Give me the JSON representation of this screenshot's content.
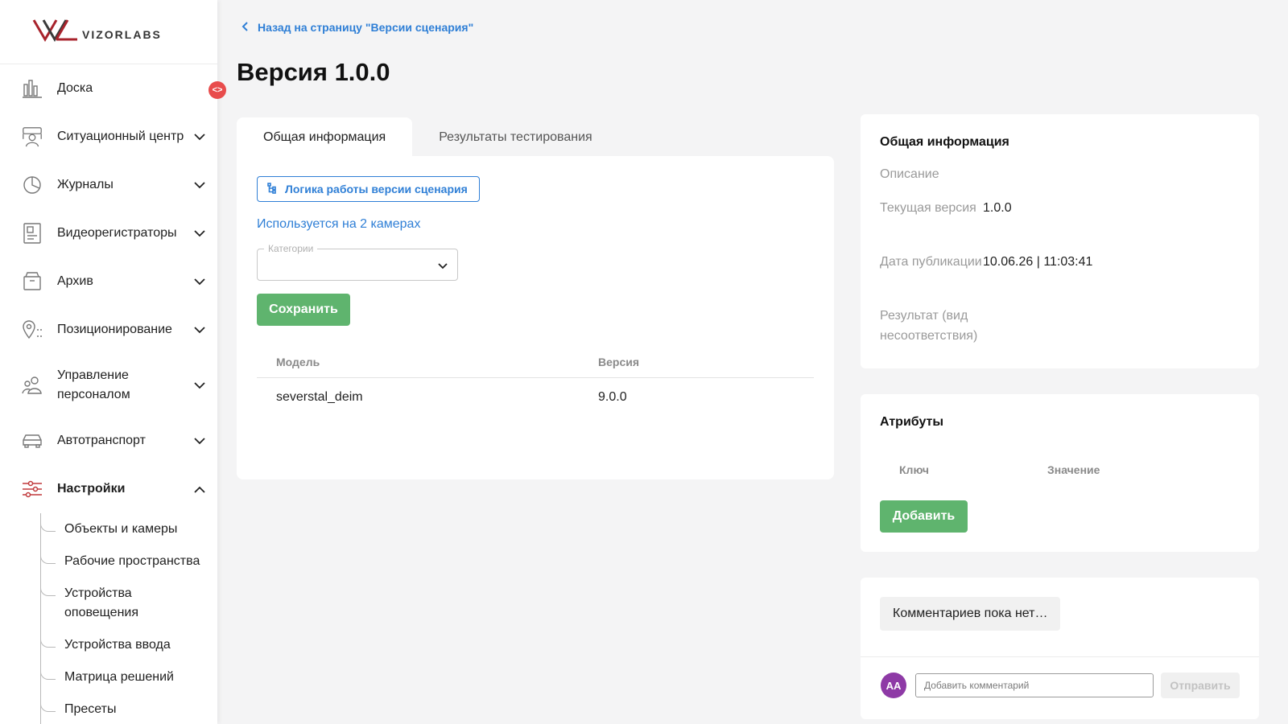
{
  "logo": {
    "text": "VIZORLABS"
  },
  "colors": {
    "accent": "#2f7fd6",
    "success": "#5fb46e",
    "brand_red": "#a8232c",
    "avatar": "#8e3aa6",
    "collapse": "#e84c4c"
  },
  "sidebar": {
    "items": [
      {
        "label": "Доска",
        "icon": "dashboard-icon"
      },
      {
        "label": "Ситуационный центр",
        "icon": "situation-center-icon"
      },
      {
        "label": "Журналы",
        "icon": "pie-chart-icon"
      },
      {
        "label": "Видеорегистраторы",
        "icon": "video-recorder-icon"
      },
      {
        "label": "Архив",
        "icon": "archive-icon"
      },
      {
        "label": "Позиционирование",
        "icon": "location-pin-icon"
      },
      {
        "label": "Управление персоналом",
        "icon": "staff-icon"
      },
      {
        "label": "Автотранспорт",
        "icon": "car-icon"
      },
      {
        "label": "Настройки",
        "icon": "settings-sliders-icon"
      }
    ],
    "subitems": [
      "Объекты и камеры",
      "Рабочие пространства",
      "Устройства оповещения",
      "Устройства ввода",
      "Матрица решений",
      "Пресеты"
    ]
  },
  "header": {
    "back_label": "Назад на страницу \"Версии сценария\"",
    "title": "Версия 1.0.0"
  },
  "tabs": [
    {
      "label": "Общая информация",
      "active": true
    },
    {
      "label": "Результаты тестирования",
      "active": false
    }
  ],
  "main": {
    "logic_button": "Логика работы версии сценария",
    "used_on": "Используется на 2 камерах",
    "category_label": "Категории",
    "category_value": "",
    "save_button": "Сохранить",
    "table": {
      "headers": [
        "Модель",
        "Версия"
      ],
      "rows": [
        [
          "severstal_deim",
          "9.0.0"
        ]
      ]
    }
  },
  "info": {
    "title": "Общая информация",
    "description_label": "Описание",
    "description_value": "",
    "current_version_label": "Текущая версия",
    "current_version_value": "1.0.0",
    "publish_date_label": "Дата публикации",
    "publish_date_value": "10.06.26 | 11:03:41",
    "result_label": "Результат (вид несоответствия)",
    "result_value": ""
  },
  "attributes": {
    "title": "Атрибуты",
    "key_header": "Ключ",
    "value_header": "Значение",
    "add_button": "Добавить"
  },
  "comments": {
    "empty_text": "Комментариев пока нет…",
    "avatar_initials": "AA",
    "input_placeholder": "Добавить комментарий",
    "send_button": "Отправить"
  }
}
